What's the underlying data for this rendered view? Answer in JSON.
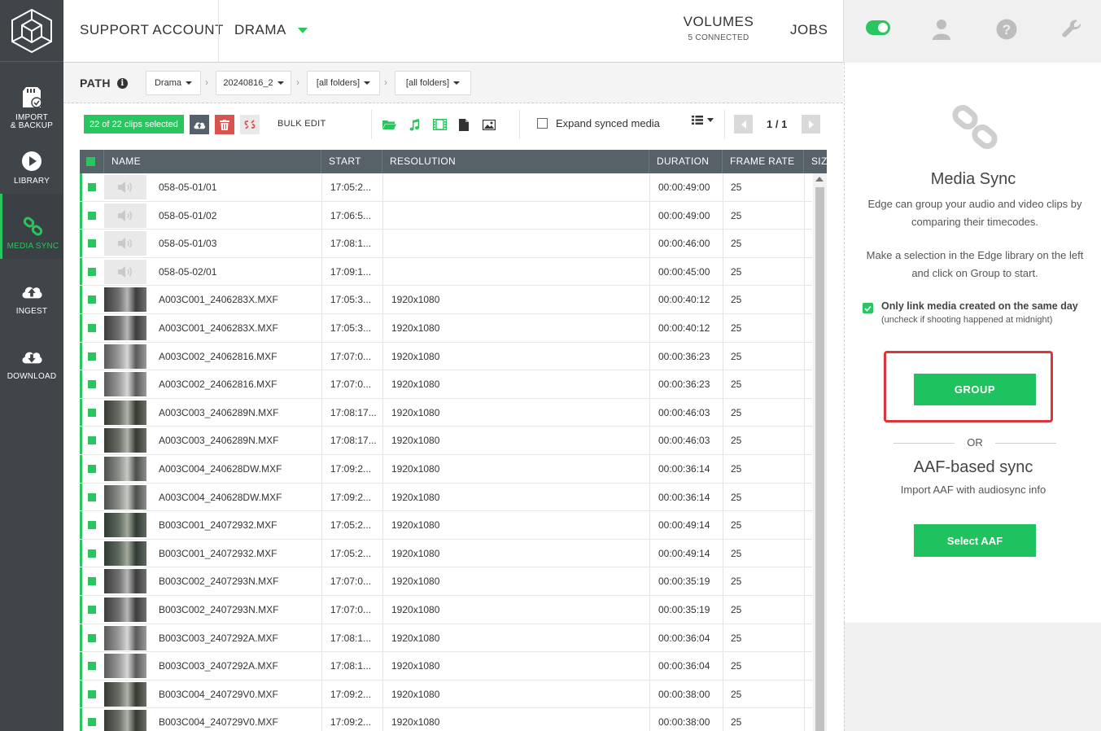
{
  "sidebar": {
    "logo": "edge-logo",
    "items": [
      {
        "label": "IMPORT\n& BACKUP",
        "icon": "sd-card-icon",
        "active": false
      },
      {
        "label": "LIBRARY",
        "icon": "play-icon",
        "active": false
      },
      {
        "label": "MEDIA SYNC",
        "icon": "link-icon",
        "active": true
      },
      {
        "label": "INGEST",
        "icon": "cloud-upload-icon",
        "active": false
      },
      {
        "label": "DOWNLOAD",
        "icon": "cloud-download-icon",
        "active": false
      }
    ]
  },
  "topbar": {
    "account": "SUPPORT ACCOUNT",
    "project": "DRAMA",
    "volumes_label": "VOLUMES",
    "volumes_status": "5 CONNECTED",
    "jobs_label": "JOBS"
  },
  "pathbar": {
    "label": "PATH",
    "crumbs": [
      "Drama",
      "20240816_2",
      "[all folders]",
      "[all folders]"
    ]
  },
  "toolbar": {
    "selected_text": "22 of 22 clips selected",
    "bulk_edit": "BULK EDIT",
    "expand_synced": "Expand synced media",
    "page_indicator": "1 / 1"
  },
  "table": {
    "headers": {
      "name": "NAME",
      "start": "START",
      "resolution": "RESOLUTION",
      "duration": "DURATION",
      "framerate": "FRAME RATE",
      "size": "SIZ"
    },
    "rows": [
      {
        "name": "058-05-01/01",
        "start": "17:05:2...",
        "resolution": "",
        "duration": "00:00:49:00",
        "framerate": "25",
        "kind": "audio"
      },
      {
        "name": "058-05-01/02",
        "start": "17:06:5...",
        "resolution": "",
        "duration": "00:00:49:00",
        "framerate": "25",
        "kind": "audio"
      },
      {
        "name": "058-05-01/03",
        "start": "17:08:1...",
        "resolution": "",
        "duration": "00:00:46:00",
        "framerate": "25",
        "kind": "audio"
      },
      {
        "name": "058-05-02/01",
        "start": "17:09:1...",
        "resolution": "",
        "duration": "00:00:45:00",
        "framerate": "25",
        "kind": "audio"
      },
      {
        "name": "A003C001_2406283X.MXF",
        "start": "17:05:3...",
        "resolution": "1920x1080",
        "duration": "00:00:40:12",
        "framerate": "25",
        "kind": "video"
      },
      {
        "name": "A003C001_2406283X.MXF",
        "start": "17:05:3...",
        "resolution": "1920x1080",
        "duration": "00:00:40:12",
        "framerate": "25",
        "kind": "video"
      },
      {
        "name": "A003C002_24062816.MXF",
        "start": "17:07:0...",
        "resolution": "1920x1080",
        "duration": "00:00:36:23",
        "framerate": "25",
        "kind": "video"
      },
      {
        "name": "A003C002_24062816.MXF",
        "start": "17:07:0...",
        "resolution": "1920x1080",
        "duration": "00:00:36:23",
        "framerate": "25",
        "kind": "video"
      },
      {
        "name": "A003C003_2406289N.MXF",
        "start": "17:08:17...",
        "resolution": "1920x1080",
        "duration": "00:00:46:03",
        "framerate": "25",
        "kind": "video"
      },
      {
        "name": "A003C003_2406289N.MXF",
        "start": "17:08:17...",
        "resolution": "1920x1080",
        "duration": "00:00:46:03",
        "framerate": "25",
        "kind": "video"
      },
      {
        "name": "A003C004_240628DW.MXF",
        "start": "17:09:2...",
        "resolution": "1920x1080",
        "duration": "00:00:36:14",
        "framerate": "25",
        "kind": "video"
      },
      {
        "name": "A003C004_240628DW.MXF",
        "start": "17:09:2...",
        "resolution": "1920x1080",
        "duration": "00:00:36:14",
        "framerate": "25",
        "kind": "video"
      },
      {
        "name": "B003C001_24072932.MXF",
        "start": "17:05:2...",
        "resolution": "1920x1080",
        "duration": "00:00:49:14",
        "framerate": "25",
        "kind": "video"
      },
      {
        "name": "B003C001_24072932.MXF",
        "start": "17:05:2...",
        "resolution": "1920x1080",
        "duration": "00:00:49:14",
        "framerate": "25",
        "kind": "video"
      },
      {
        "name": "B003C002_2407293N.MXF",
        "start": "17:07:0...",
        "resolution": "1920x1080",
        "duration": "00:00:35:19",
        "framerate": "25",
        "kind": "video"
      },
      {
        "name": "B003C002_2407293N.MXF",
        "start": "17:07:0...",
        "resolution": "1920x1080",
        "duration": "00:00:35:19",
        "framerate": "25",
        "kind": "video"
      },
      {
        "name": "B003C003_2407292A.MXF",
        "start": "17:08:1...",
        "resolution": "1920x1080",
        "duration": "00:00:36:04",
        "framerate": "25",
        "kind": "video"
      },
      {
        "name": "B003C003_2407292A.MXF",
        "start": "17:08:1...",
        "resolution": "1920x1080",
        "duration": "00:00:36:04",
        "framerate": "25",
        "kind": "video"
      },
      {
        "name": "B003C004_240729V0.MXF",
        "start": "17:09:2...",
        "resolution": "1920x1080",
        "duration": "00:00:38:00",
        "framerate": "25",
        "kind": "video"
      },
      {
        "name": "B003C004_240729V0.MXF",
        "start": "17:09:2...",
        "resolution": "1920x1080",
        "duration": "00:00:38:00",
        "framerate": "25",
        "kind": "video"
      }
    ]
  },
  "media_sync": {
    "title": "Media Sync",
    "description": "Edge can group your audio and video clips by comparing their timecodes.",
    "instruction": "Make a selection in the Edge library on the left and click on Group to start.",
    "same_day_label": "Only link media created on the same day",
    "same_day_hint": "(uncheck if shooting happened at midnight)",
    "same_day_checked": true,
    "group_button": "GROUP",
    "or_text": "OR",
    "aaf_title": "AAF-based sync",
    "aaf_desc": "Import AAF with audiosync info",
    "aaf_button": "Select AAF"
  },
  "colors": {
    "accent": "#29c55f",
    "sidebar_bg": "#3f4549",
    "header_bg": "#566168",
    "highlight_outline": "#d9363e"
  }
}
